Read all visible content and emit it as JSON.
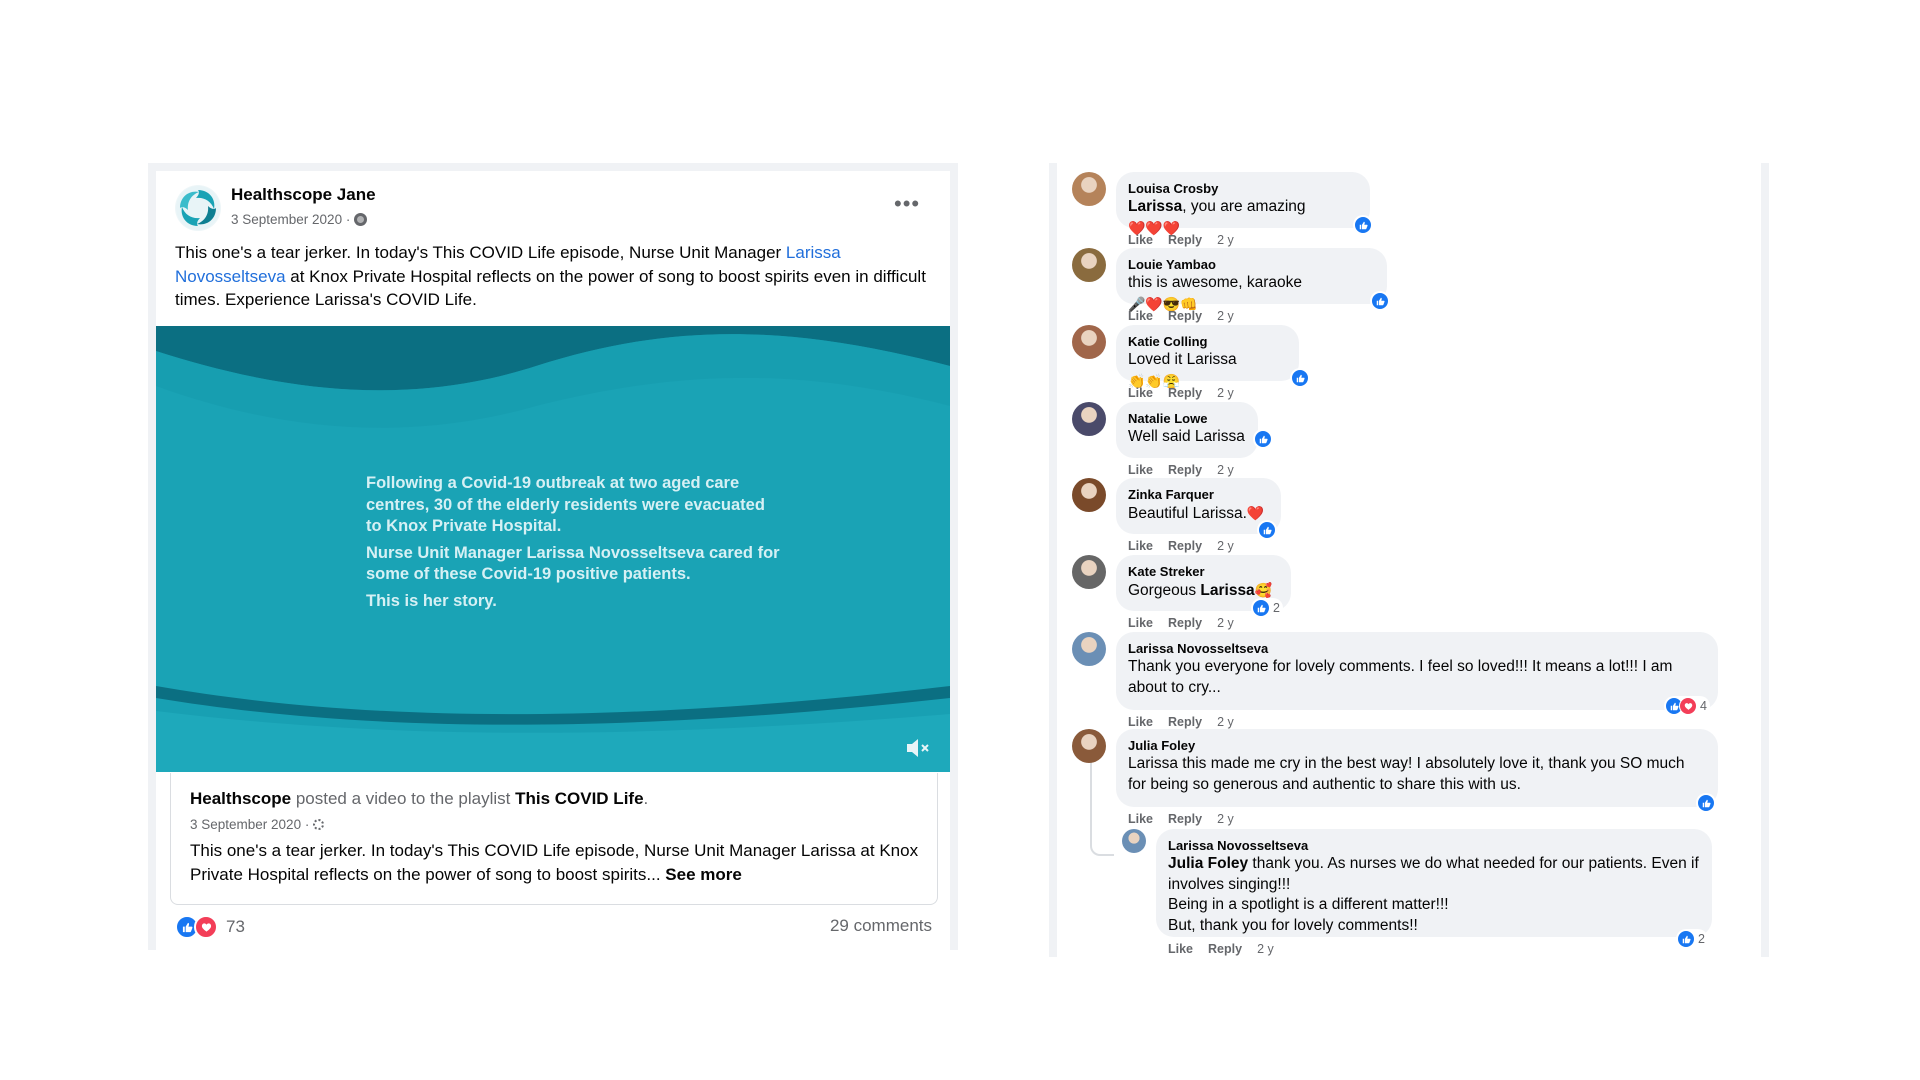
{
  "post": {
    "page_name": "Healthscope Jane",
    "date": "3 September 2020 ·",
    "text_before_link": "This one's a tear jerker. In today's This COVID Life episode, Nurse Unit Manager ",
    "link_text": "Larissa Novosseltseva",
    "text_after_link": " at Knox Private Hospital reflects on the power of song to boost spirits even in difficult times. Experience Larissa's COVID Life.",
    "more_icon": "three-dots-icon",
    "video": {
      "lines": [
        "Following a Covid-19 outbreak at two aged care centres, 30 of the elderly residents were evacuated to Knox Private Hospital.",
        "Nurse Unit Manager Larissa Novosseltseva cared for some of these Covid-19 positive patients.",
        "This is her story."
      ],
      "colors": {
        "base": "#1aa3b5",
        "dark": "#0b6f82",
        "light": "#3bbccb"
      },
      "mute_icon": "speaker-muted-icon"
    },
    "shared": {
      "author": "Healthscope",
      "action": " posted a video to the playlist ",
      "playlist": "This COVID Life",
      "period": ".",
      "date": "3 September 2020 ·",
      "text": "This one's a tear jerker. In today's This COVID Life episode, Nurse Unit Manager Larissa at Knox Private Hospital reflects on the power of song to boost spirits... ",
      "see_more": "See more"
    },
    "reaction_count": "73",
    "comments_label": "29 comments"
  },
  "actions": {
    "like": "Like",
    "reply": "Reply"
  },
  "comments": [
    {
      "name": "Louisa Crosby",
      "bold_prefix": "Larissa",
      "text": ", you are amazing ",
      "emoji": "❤️❤️❤️",
      "time": "2 y",
      "avatar_color": "#b5835a",
      "reaction_count": ""
    },
    {
      "name": "Louie Yambao",
      "bold_prefix": "",
      "text": "this is awesome, karaoke ",
      "emoji": "🎤❤️😎👊",
      "time": "2 y",
      "avatar_color": "#8a6b3e",
      "reaction_count": ""
    },
    {
      "name": "Katie Colling",
      "bold_prefix": "",
      "text": "Loved it Larissa ",
      "emoji": "👏👏😤",
      "time": "2 y",
      "avatar_color": "#a0664a",
      "reaction_count": ""
    },
    {
      "name": "Natalie Lowe",
      "bold_prefix": "",
      "text": "Well said Larissa",
      "emoji": "",
      "time": "2 y",
      "avatar_color": "#4a4a6a",
      "reaction_count": ""
    },
    {
      "name": "Zinka Farquer",
      "bold_prefix": "",
      "text": "Beautiful Larissa.",
      "emoji": "❤️",
      "time": "2 y",
      "avatar_color": "#7a4a2a",
      "reaction_count": ""
    },
    {
      "name": "Kate Streker",
      "bold_prefix": "",
      "text": "Gorgeous ",
      "bold_suffix": "Larissa",
      "emoji": "🥰",
      "time": "2 y",
      "avatar_color": "#666666",
      "reaction_count": "2"
    },
    {
      "name": "Larissa Novosseltseva",
      "bold_prefix": "",
      "text": "Thank you everyone for lovely comments. I feel so loved!!! It means a lot!!! I am about to cry...",
      "emoji": "",
      "time": "2 y",
      "avatar_color": "#6b8fb5",
      "reaction_count": "4"
    },
    {
      "name": "Julia Foley",
      "bold_prefix": "",
      "text": "Larissa this made me cry in the best way! I absolutely love it, thank you SO much for being so generous and authentic to share this with us.",
      "emoji": "",
      "time": "2 y",
      "avatar_color": "#8a5a3a",
      "reaction_count": ""
    }
  ],
  "reply": {
    "name": "Larissa Novosseltseva",
    "mention": "Julia Foley",
    "lines": [
      " thank you. As nurses we do what needed for our patients. Even if involves singing!!!",
      "Being in a spotlight is a different matter!!!",
      "But, thank you for lovely comments!!"
    ],
    "time": "2 y",
    "avatar_color": "#6b8fb5",
    "reaction_count": "2"
  }
}
